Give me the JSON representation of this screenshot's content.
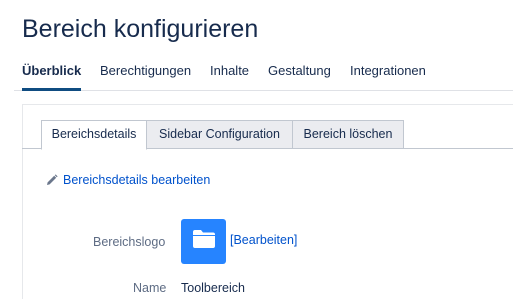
{
  "page": {
    "title": "Bereich konfigurieren"
  },
  "main_tabs": [
    {
      "label": "Überblick",
      "active": true
    },
    {
      "label": "Berechtigungen",
      "active": false
    },
    {
      "label": "Inhalte",
      "active": false
    },
    {
      "label": "Gestaltung",
      "active": false
    },
    {
      "label": "Integrationen",
      "active": false
    }
  ],
  "sub_tabs": [
    {
      "label": "Bereichsdetails",
      "active": true
    },
    {
      "label": "Sidebar Configuration",
      "active": false
    },
    {
      "label": "Bereich löschen",
      "active": false
    }
  ],
  "details": {
    "edit_link": "Bereichsdetails bearbeiten",
    "edit_icon": "pencil-icon",
    "logo_label": "Bereichslogo",
    "logo_icon": "folder-icon",
    "logo_edit": "[Bearbeiten]",
    "name_label": "Name",
    "name_value": "Toolbereich"
  },
  "colors": {
    "accent": "#0f4c81",
    "link": "#0052cc",
    "logo_bg": "#2684ff"
  }
}
